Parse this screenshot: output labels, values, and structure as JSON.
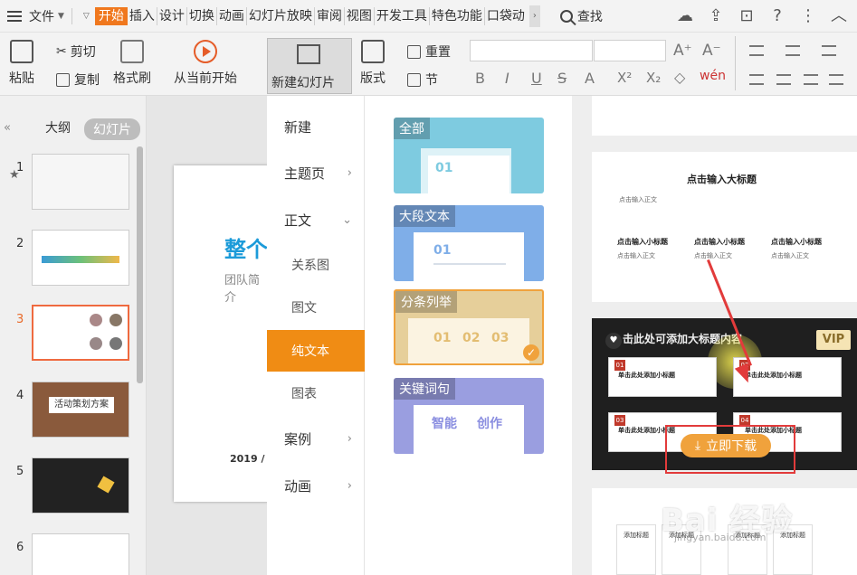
{
  "menu": {
    "file": "文件",
    "tabs": [
      "开始",
      "插入",
      "设计",
      "切换",
      "动画",
      "幻灯片放映",
      "审阅",
      "视图",
      "开发工具",
      "特色功能",
      "口袋动"
    ],
    "active_tab": "开始",
    "search": "查找"
  },
  "ribbon": {
    "paste": "粘贴",
    "cut": "剪切",
    "copy": "复制",
    "format_painter": "格式刷",
    "from_current": "从当前开始",
    "new_slide": "新建幻灯片",
    "layout": "版式",
    "reset": "重置",
    "section": "节",
    "format_letters": [
      "B",
      "I",
      "U",
      "S",
      "A",
      "X²",
      "X₂"
    ]
  },
  "left_panel": {
    "outline_tab": "大纲",
    "slides_tab": "幻灯片",
    "slide_numbers": [
      "1",
      "2",
      "3",
      "4",
      "5",
      "6"
    ],
    "current_slide": "3",
    "thumb4_title": "活动策划方案"
  },
  "slide": {
    "title": "整个",
    "subtitle": "团队简介",
    "year": "2019 /"
  },
  "dropdown": {
    "items": [
      {
        "label": "新建",
        "arrow": ""
      },
      {
        "label": "主题页",
        "arrow": "›"
      },
      {
        "label": "正文",
        "arrow": "⌄"
      },
      {
        "label": "关系图",
        "arrow": ""
      },
      {
        "label": "图文",
        "arrow": ""
      },
      {
        "label": "纯文本",
        "arrow": ""
      },
      {
        "label": "图表",
        "arrow": ""
      },
      {
        "label": "案例",
        "arrow": "›"
      },
      {
        "label": "动画",
        "arrow": "›"
      }
    ],
    "selected": "纯文本"
  },
  "templates": {
    "cards": [
      {
        "label": "全部",
        "bg": "#7ecbe0",
        "nums": [
          "01"
        ]
      },
      {
        "label": "大段文本",
        "bg": "#7faee8",
        "nums": [
          "01"
        ]
      },
      {
        "label": "分条列举",
        "bg": "#e6cf9a",
        "nums": [
          "01",
          "02",
          "03"
        ]
      },
      {
        "label": "关键词句",
        "bg": "#9a9ee0",
        "nums": [
          "智能",
          "创作"
        ]
      }
    ]
  },
  "preview": {
    "slide1": {
      "title": "点击输入大标题",
      "small_text": "点击输入正文",
      "subtitles": [
        "点击输入小标题",
        "点击输入小标题",
        "点击输入小标题"
      ],
      "sub_text": "点击输入正文"
    },
    "slide2": {
      "title": "击此处可添加大标题内容",
      "vip": "VIP",
      "heart": "♥",
      "box_title": "单击此处添加小标题",
      "box_nums": [
        "01",
        "02",
        "03",
        "04"
      ],
      "download": "立即下载"
    },
    "slide3": {
      "items": [
        "添加标题",
        "添加标题",
        "添加标题",
        "添加标题"
      ]
    },
    "watermark": "Bai 经验",
    "watermark_sub": "jingyan.baidu.com"
  }
}
